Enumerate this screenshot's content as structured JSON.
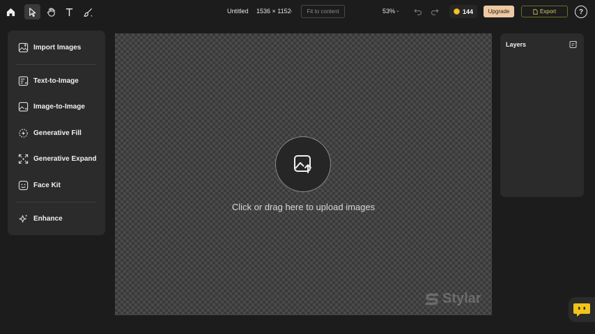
{
  "toolbar": {
    "tools": [
      {
        "name": "home",
        "icon": "home-icon"
      },
      {
        "name": "select",
        "icon": "cursor-icon",
        "active": true
      },
      {
        "name": "hand",
        "icon": "hand-icon"
      },
      {
        "name": "text",
        "icon": "text-icon"
      },
      {
        "name": "brush",
        "icon": "brush-icon"
      }
    ],
    "doc_title": "Untitled",
    "doc_size": "1536 × 1152",
    "fit_label": "Fit to content",
    "zoom": "53%",
    "credits": "144",
    "upgrade_label": "Upgrade",
    "export_label": "Export",
    "help_label": "?"
  },
  "sidebar": {
    "items": [
      {
        "label": "Import Images",
        "icon": "import-image-icon"
      },
      {
        "label": "Text-to-Image",
        "icon": "text-to-image-icon"
      },
      {
        "label": "Image-to-Image",
        "icon": "image-to-image-icon"
      },
      {
        "label": "Generative Fill",
        "icon": "generative-fill-icon"
      },
      {
        "label": "Generative Expand",
        "icon": "generative-expand-icon"
      },
      {
        "label": "Face Kit",
        "icon": "face-icon"
      },
      {
        "label": "Enhance",
        "icon": "sparkle-icon"
      }
    ]
  },
  "canvas": {
    "upload_text": "Click or drag here to upload images",
    "watermark": "Stylar"
  },
  "layers": {
    "title": "Layers"
  },
  "colors": {
    "background": "#1c1c1c",
    "panel": "#2b2b2b",
    "upgrade": "#efc9a4",
    "export_accent": "#d9c96a",
    "chat_bot": "#f0c419"
  }
}
